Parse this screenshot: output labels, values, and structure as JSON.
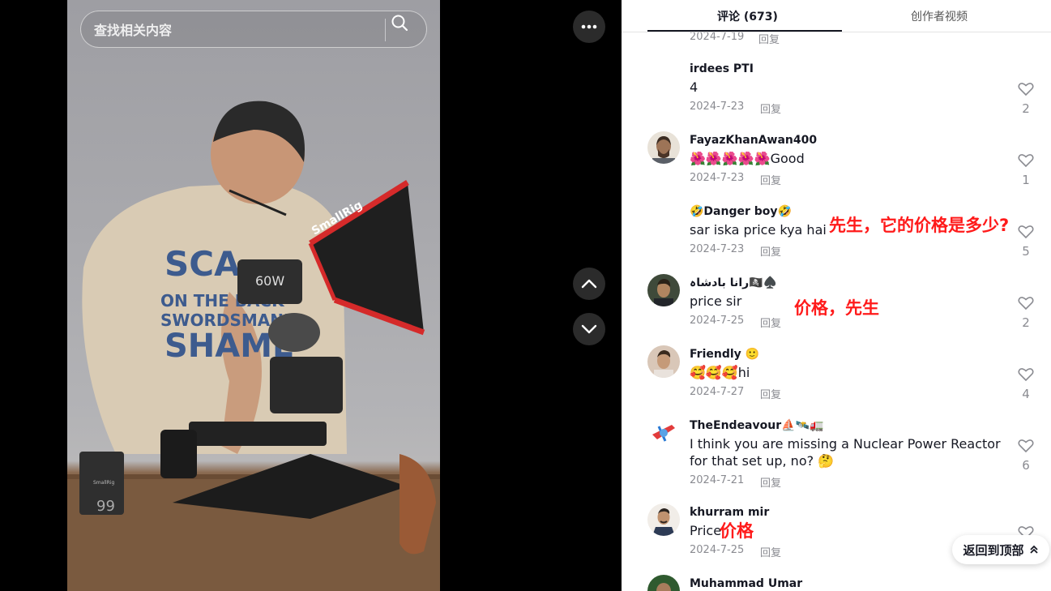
{
  "search": {
    "placeholder": "查找相关内容"
  },
  "video": {
    "battery_label": "99",
    "brand_text": "SmallRig",
    "shirt_text": "SCA ON THE BACK ARE A SWORDSMAN'S SHAME",
    "light_label": "60W"
  },
  "tabs": [
    {
      "label": "评论 (673)",
      "active": true
    },
    {
      "label": "创作者视频",
      "active": false
    }
  ],
  "partial_comment": {
    "date": "2024-7-19",
    "reply": "回复"
  },
  "comments": [
    {
      "username": "irdees PTI",
      "text": "4",
      "date": "2024-7-23",
      "reply": "回复",
      "likes": "2",
      "avatar": "none"
    },
    {
      "username": "FayazKhanAwan400",
      "text": "🌺🌺🌺🌺🌺Good",
      "date": "2024-7-23",
      "reply": "回复",
      "likes": "1",
      "avatar": "photo"
    },
    {
      "username": "🤣Danger boy🤣",
      "text": "sar iska price kya hai",
      "date": "2024-7-23",
      "reply": "回复",
      "likes": "5",
      "avatar": "none"
    },
    {
      "username": "رانا بادشاہ🏴‍☠️♠️",
      "text": "price sir",
      "date": "2024-7-25",
      "reply": "回复",
      "likes": "2",
      "avatar": "photo"
    },
    {
      "username": "Friendly 🙂",
      "text": "🥰🥰🥰hi",
      "date": "2024-7-27",
      "reply": "回复",
      "likes": "4",
      "avatar": "photo"
    },
    {
      "username": "TheEndeavour⛵🛰️🚛",
      "text": "I think you are missing a Nuclear Power Reactor for that set up, no? 🤔",
      "date": "2024-7-21",
      "reply": "回复",
      "likes": "6",
      "avatar": "cartoon"
    },
    {
      "username": "khurram mir",
      "text": "Price",
      "date": "2024-7-25",
      "reply": "回复",
      "likes": "",
      "avatar": "photo"
    },
    {
      "username": "Muhammad Umar",
      "text": "",
      "date": "",
      "reply": "",
      "likes": "",
      "avatar": "photo"
    }
  ],
  "annotations": [
    "先生，它的价格是多少?",
    "价格，先生",
    "价格"
  ],
  "back_to_top": "返回到顶部",
  "colors": {
    "annotation": "#ff1a1a",
    "muted": "#8a8b91",
    "text": "#161823"
  }
}
